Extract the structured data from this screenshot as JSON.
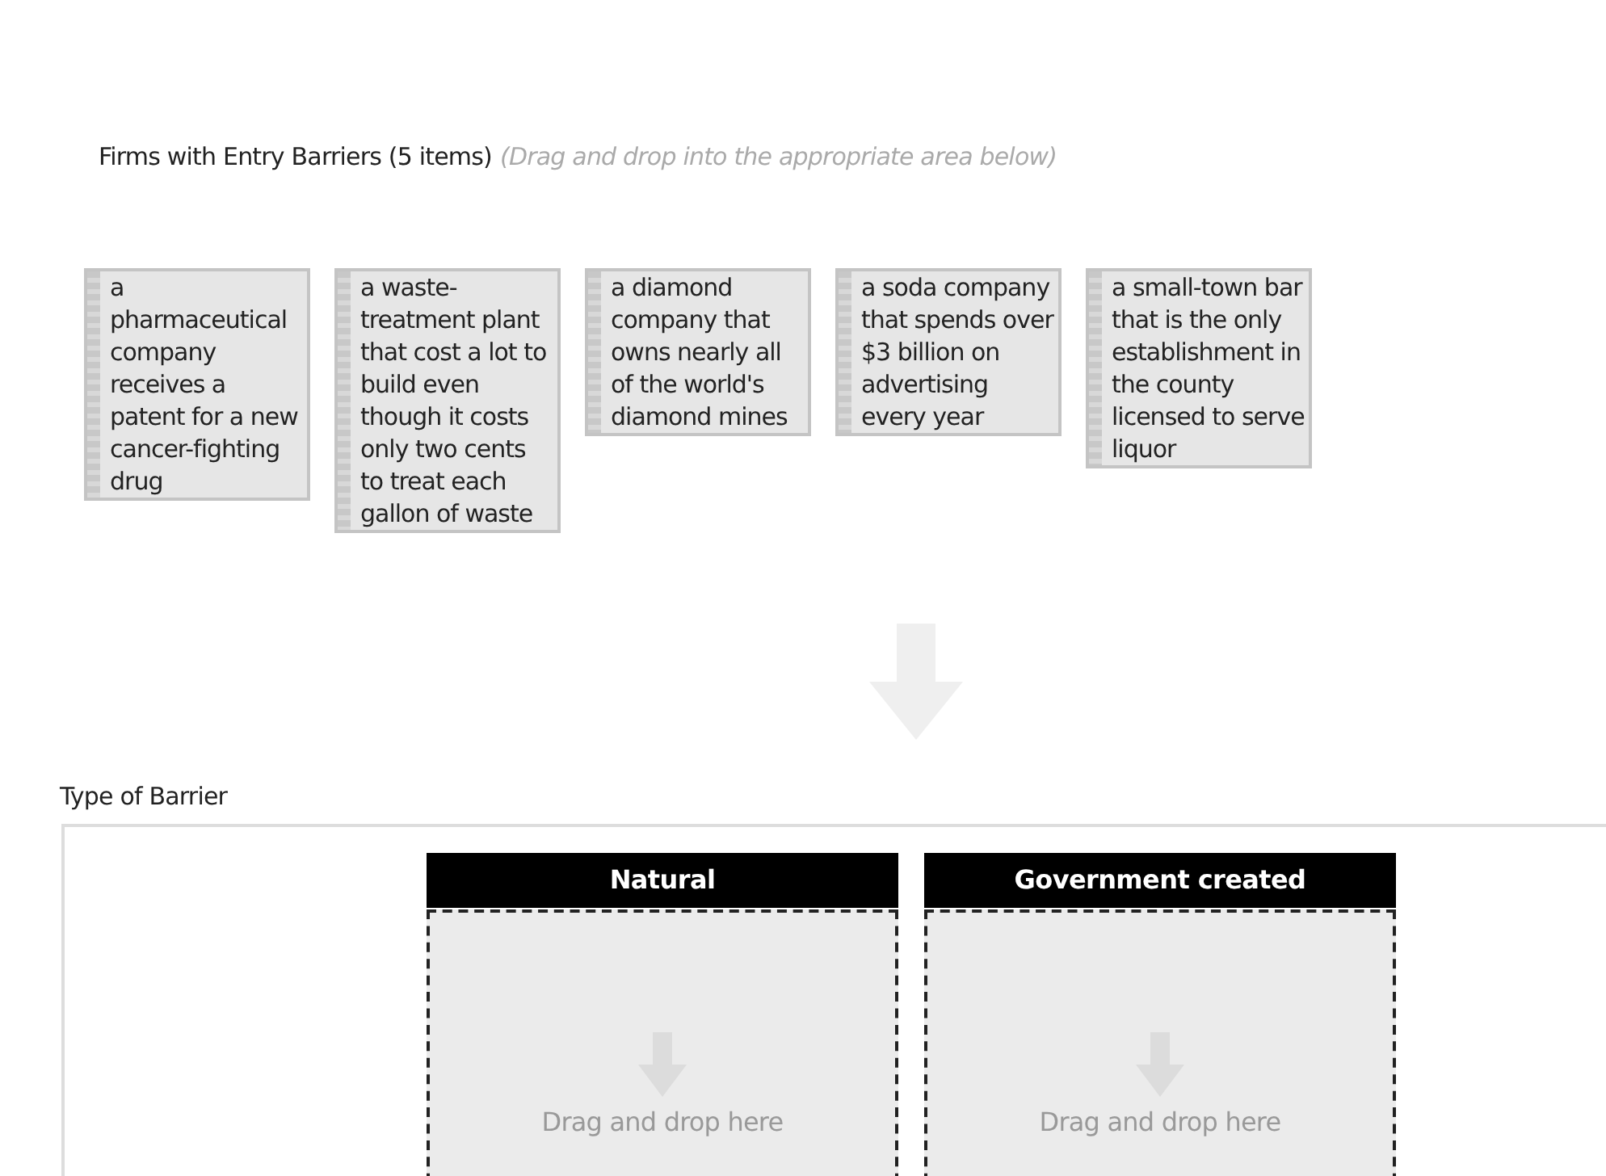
{
  "source": {
    "title": "Firms with Entry Barriers (5 items)",
    "hint": "(Drag and drop into the appropriate area below)",
    "items": [
      {
        "text": "a pharmaceutical company receives a patent for a new cancer-fighting drug"
      },
      {
        "text": "a waste-treatment plant that cost a lot to build even though it costs only two cents to treat each gallon of waste"
      },
      {
        "text": "a diamond company that owns nearly all of the world's diamond mines"
      },
      {
        "text": "a soda company that spends over $3 billion on advertising every year"
      },
      {
        "text": "a small-town bar that is the only establishment in the county licensed to serve liquor"
      }
    ]
  },
  "target": {
    "title": "Type of Barrier",
    "categories": [
      {
        "label": "Natural",
        "placeholder": "Drag and drop here"
      },
      {
        "label": "Government created",
        "placeholder": "Drag and drop here"
      }
    ]
  }
}
